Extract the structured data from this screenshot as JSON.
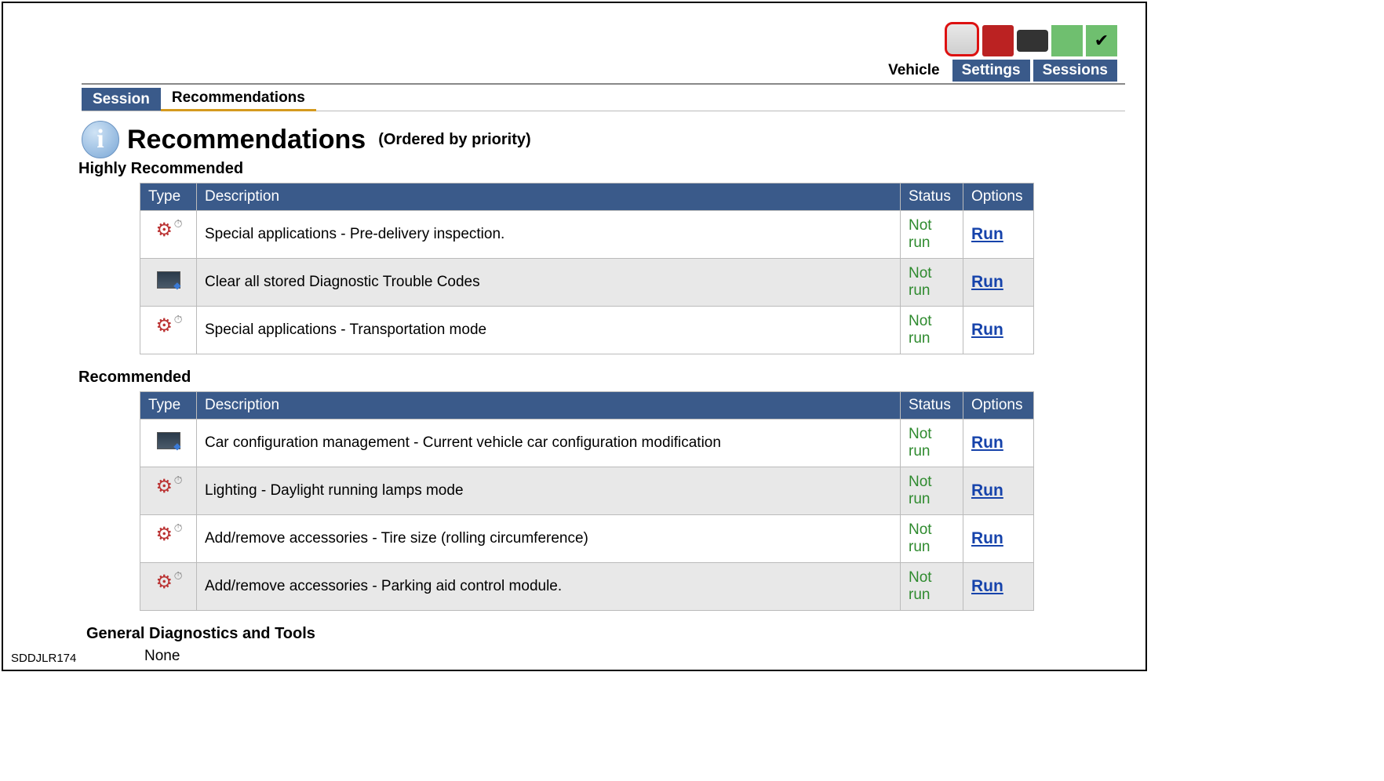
{
  "toolbar": {
    "labels": {
      "vehicle": "Vehicle",
      "settings": "Settings",
      "sessions": "Sessions"
    }
  },
  "tabs": {
    "session": "Session",
    "recommendations": "Recommendations"
  },
  "title": {
    "main": "Recommendations",
    "subtitle": "(Ordered by priority)"
  },
  "sections": {
    "highly": {
      "heading": "Highly Recommended",
      "columns": {
        "type": "Type",
        "description": "Description",
        "status": "Status",
        "options": "Options"
      },
      "rows": [
        {
          "icon": "gear",
          "description": "Special applications - Pre-delivery inspection.",
          "status": "Not run",
          "option": "Run"
        },
        {
          "icon": "screen",
          "description": "Clear all stored Diagnostic Trouble Codes",
          "status": "Not run",
          "option": "Run"
        },
        {
          "icon": "gear",
          "description": "Special applications - Transportation mode",
          "status": "Not run",
          "option": "Run"
        }
      ]
    },
    "recommended": {
      "heading": "Recommended",
      "columns": {
        "type": "Type",
        "description": "Description",
        "status": "Status",
        "options": "Options"
      },
      "rows": [
        {
          "icon": "screen",
          "description": "Car configuration management - Current vehicle car configuration modification",
          "status": "Not run",
          "option": "Run"
        },
        {
          "icon": "gear",
          "description": "Lighting - Daylight running lamps mode",
          "status": "Not run",
          "option": "Run"
        },
        {
          "icon": "gear",
          "description": "Add/remove accessories - Tire size (rolling circumference)",
          "status": "Not run",
          "option": "Run"
        },
        {
          "icon": "gear",
          "description": "Add/remove accessories - Parking aid control module.",
          "status": "Not run",
          "option": "Run"
        }
      ]
    },
    "general": {
      "heading": "General Diagnostics and Tools",
      "none": "None"
    }
  },
  "footer": {
    "code": "SDDJLR174"
  }
}
